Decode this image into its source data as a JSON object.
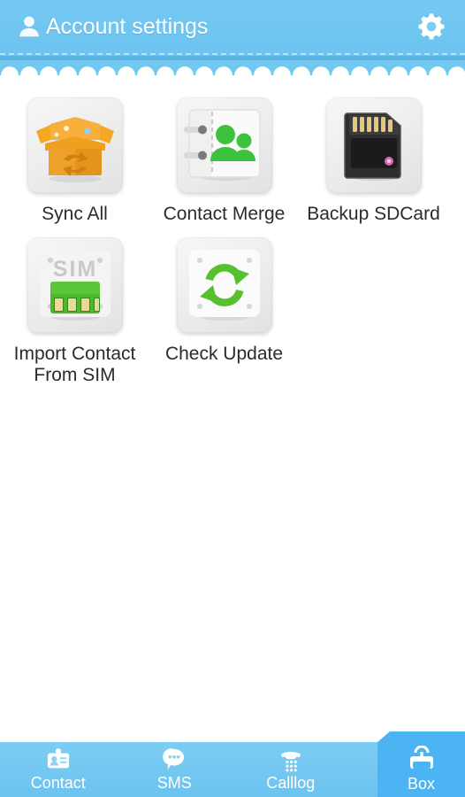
{
  "header": {
    "title": "Account settings",
    "person_icon": "person-icon",
    "settings_icon": "gear-icon",
    "bg_color": "#6dc4f0",
    "band_color": "#5bb5e4",
    "text_color": "#ffffff"
  },
  "grid": {
    "items": [
      {
        "label": "Sync All",
        "icon": "sync-box-icon"
      },
      {
        "label": "Contact Merge",
        "icon": "contact-book-icon"
      },
      {
        "label": "Backup SDCard",
        "icon": "sdcard-icon"
      },
      {
        "label": "Import Contact\nFrom SIM",
        "icon": "sim-card-icon"
      },
      {
        "label": "Check Update",
        "icon": "refresh-arrows-icon"
      }
    ]
  },
  "bottom_nav": {
    "items": [
      {
        "label": "Contact",
        "icon": "contact-card-icon",
        "active": false
      },
      {
        "label": "SMS",
        "icon": "speech-bubble-icon",
        "active": false
      },
      {
        "label": "Calllog",
        "icon": "phone-keypad-icon",
        "active": false
      },
      {
        "label": "Box",
        "icon": "toolbox-icon",
        "active": true
      }
    ],
    "bg_color": "#6cc3ef",
    "active_color": "#4cb4f2",
    "label_color": "#ffffff"
  }
}
